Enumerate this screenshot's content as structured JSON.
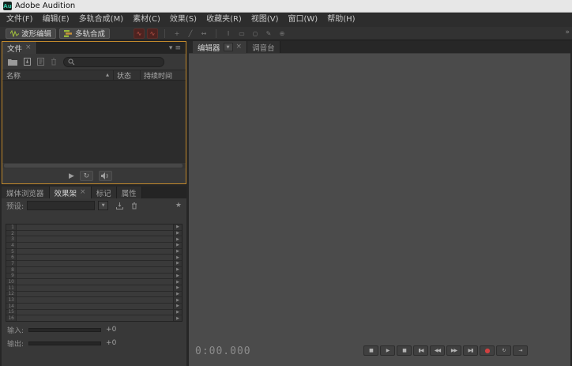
{
  "titlebar": {
    "app_title": "Adobe Audition"
  },
  "menubar": {
    "items": [
      "文件(F)",
      "编辑(E)",
      "多轨合成(M)",
      "素材(C)",
      "效果(S)",
      "收藏夹(R)",
      "视图(V)",
      "窗口(W)",
      "帮助(H)"
    ]
  },
  "toolbar": {
    "waveform_label": "波形编辑",
    "multitrack_label": "多轨合成",
    "overflow_glyph": "»",
    "tools": [
      {
        "name": "spectral-frequency-display-icon",
        "glyph": "∿",
        "style": "red"
      },
      {
        "name": "spectral-pitch-display-icon",
        "glyph": "∿",
        "style": "red"
      },
      {
        "type": "sep"
      },
      {
        "name": "move-tool-icon",
        "glyph": "+",
        "style": "dim"
      },
      {
        "name": "razor-tool-icon",
        "glyph": "╱",
        "style": "dim"
      },
      {
        "name": "slip-tool-icon",
        "glyph": "↔",
        "style": "dim"
      },
      {
        "type": "sep"
      },
      {
        "name": "time-selection-tool-icon",
        "glyph": "I",
        "style": "dim"
      },
      {
        "name": "marquee-selection-tool-icon",
        "glyph": "▭",
        "style": "dim"
      },
      {
        "name": "lasso-selection-tool-icon",
        "glyph": "○",
        "style": "dim"
      },
      {
        "name": "paintbrush-tool-icon",
        "glyph": "✎",
        "style": "dim"
      },
      {
        "name": "spot-healing-brush-icon",
        "glyph": "⊕",
        "style": "dim"
      }
    ]
  },
  "files_panel": {
    "tab_label": "文件",
    "close_glyph": "×",
    "panel_menu_glyphs": {
      "caret": "▾",
      "menu": "≡"
    },
    "columns": {
      "name": "名称",
      "status": "状态",
      "duration": "持续时间"
    },
    "sort_glyph": "▲"
  },
  "rack_panel": {
    "tabs": {
      "media_browser": "媒体浏览器",
      "effects_rack": "效果架",
      "markers": "标记",
      "properties": "属性"
    },
    "close_glyph": "×",
    "presets_label": "预设:",
    "slot_numbers": [
      "1",
      "2",
      "3",
      "4",
      "5",
      "6",
      "7",
      "8",
      "9",
      "10",
      "11",
      "12",
      "13",
      "14",
      "15",
      "16"
    ],
    "slot_arrow_glyph": "▶",
    "star_glyph": "★",
    "input_label": "输入:",
    "output_label": "输出:",
    "input_gain": "+0",
    "output_gain": "+0"
  },
  "editor_panel": {
    "tabs": {
      "editor": "编辑器",
      "mixer": "调音台"
    },
    "dropdown_glyph": "▼",
    "close_glyph": "×",
    "time_display": "0:00.000"
  },
  "transport": {
    "buttons": [
      {
        "name": "stop",
        "glyph": "■"
      },
      {
        "name": "play",
        "glyph": "▶"
      },
      {
        "name": "pause",
        "glyph": "▮▮"
      },
      {
        "name": "move-to-previous",
        "glyph": "▮◀"
      },
      {
        "name": "rewind",
        "glyph": "◀◀"
      },
      {
        "name": "fast-forward",
        "glyph": "▶▶"
      },
      {
        "name": "move-to-next",
        "glyph": "▶▮"
      },
      {
        "name": "record",
        "glyph": "●"
      },
      {
        "name": "loop-playback",
        "glyph": "↻"
      },
      {
        "name": "skip-selection",
        "glyph": "⇥"
      }
    ]
  },
  "colors": {
    "focus_border_orange": "#c0882c",
    "record_red": "#d04040",
    "editor_background": "#4b4b4b",
    "menubar_background": "#2d2d2d"
  }
}
